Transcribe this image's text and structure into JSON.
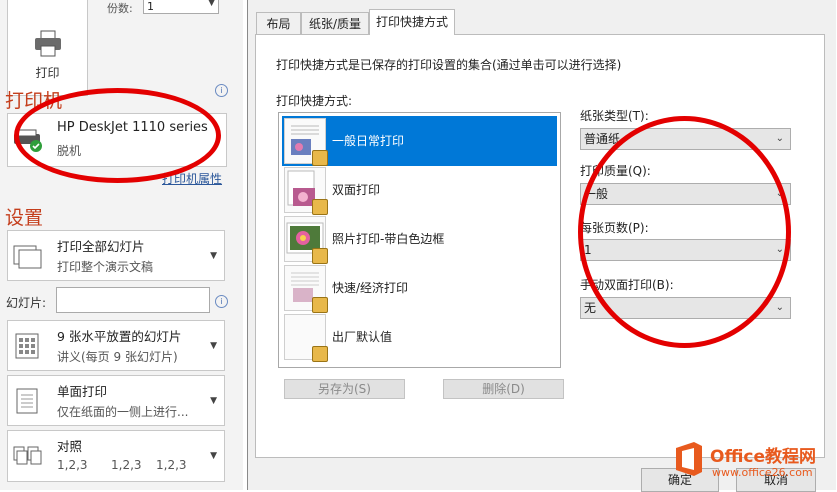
{
  "left_pane": {
    "print_button": "打印",
    "copies_label": "份数:",
    "copies_value": "1",
    "printer_section_title": "打印机",
    "printer_name": "HP DeskJet 1110 series",
    "printer_status": "脱机",
    "printer_properties_link": "打印机属性",
    "settings_section_title": "设置",
    "slides_label": "幻灯片:",
    "options": [
      {
        "line1": "打印全部幻灯片",
        "line2": "打印整个演示文稿"
      },
      {
        "line1": "9 张水平放置的幻灯片",
        "line2": "讲义(每页 9 张幻灯片)"
      },
      {
        "line1": "单面打印",
        "line2": "仅在纸面的一侧上进行..."
      },
      {
        "line1": "对照",
        "line2a": "1,2,3",
        "line2b": "1,2,3",
        "line2c": "1,2,3"
      }
    ]
  },
  "dialog": {
    "tabs": [
      "布局",
      "纸张/质量",
      "打印快捷方式"
    ],
    "selected_tab": "打印快捷方式",
    "description": "打印快捷方式是已保存的打印设置的集合(通过单击可以进行选择)",
    "list_label": "打印快捷方式:",
    "shortcuts": [
      "一般日常打印",
      "双面打印",
      "照片打印-带白色边框",
      "快速/经济打印",
      "出厂默认值"
    ],
    "selected_shortcut": "一般日常打印",
    "save_as_button": "另存为(S)",
    "delete_button": "删除(D)",
    "paper_type_label": "纸张类型(T):",
    "paper_type_value": "普通纸",
    "print_quality_label": "打印质量(Q):",
    "print_quality_value": "一般",
    "pages_per_sheet_label": "每张页数(P):",
    "pages_per_sheet_value": "1",
    "manual_duplex_label": "手动双面打印(B):",
    "manual_duplex_value": "无",
    "ok_button": "确定",
    "cancel_button": "取消"
  },
  "watermark": {
    "brand": "Office教程网",
    "url": "www.office26.com"
  },
  "colors": {
    "accent": "#c43e1c",
    "selection": "#0078d7",
    "annotation": "#e30000",
    "watermark": "#e85a1e"
  }
}
